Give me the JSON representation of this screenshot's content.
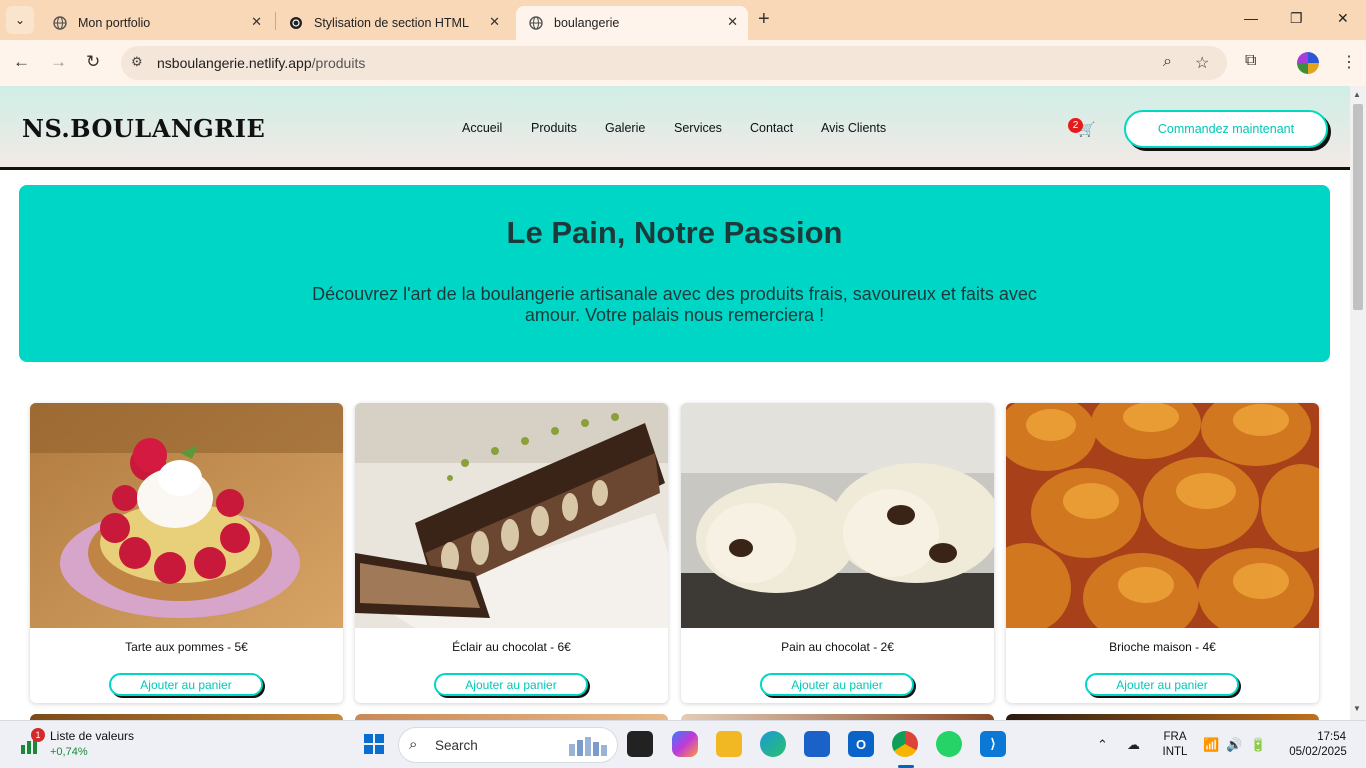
{
  "browser": {
    "tabs": [
      {
        "title": "Mon portfolio"
      },
      {
        "title": "Stylisation de section HTML"
      },
      {
        "title": "boulangerie"
      }
    ],
    "url_domain": "nsboulangerie.netlify.app",
    "url_path": "/produits"
  },
  "site": {
    "logo": "NS.BOULANGRIE",
    "menu": [
      "Accueil",
      "Produits",
      "Galerie",
      "Services",
      "Contact",
      "Avis Clients"
    ],
    "cart_count": "2",
    "order_button": "Commandez maintenant",
    "hero_title": "Le Pain, Notre Passion",
    "hero_text": "Découvrez l'art de la boulangerie artisanale avec des produits frais, savoureux et faits avec amour. Votre palais nous remerciera !",
    "add_to_cart_label": "Ajouter au panier",
    "products": [
      {
        "title": "Tarte aux pommes - 5€"
      },
      {
        "title": "Éclair au chocolat - 6€"
      },
      {
        "title": "Pain au chocolat - 2€"
      },
      {
        "title": "Brioche maison - 4€"
      }
    ]
  },
  "taskbar": {
    "widget_title": "Liste de valeurs",
    "widget_value": "+0,74%",
    "widget_badge": "1",
    "search_label": "Search",
    "lang_line1": "FRA",
    "lang_line2": "INTL",
    "time": "17:54",
    "date": "05/02/2025"
  },
  "colors": {
    "accent": "#00d6c6",
    "tabstrip": "#f9d8b8",
    "toolbar": "#fff4ec"
  }
}
